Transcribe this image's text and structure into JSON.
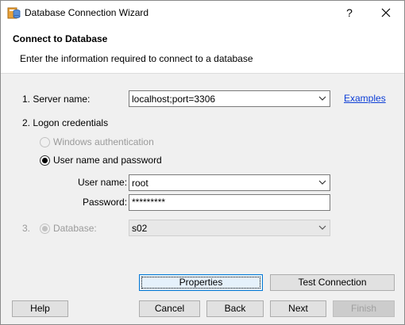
{
  "window": {
    "title": "Database Connection Wizard",
    "help_glyph": "?",
    "icon": "database-wizard-icon"
  },
  "header": {
    "title": "Connect to Database",
    "subtitle": "Enter the information required to connect to a database"
  },
  "server": {
    "label": "1. Server name:",
    "value": "localhost;port=3306",
    "examples_link": "Examples"
  },
  "logon": {
    "label": "2. Logon credentials",
    "windows_auth_label": "Windows authentication",
    "userpass_label": "User name and password",
    "selected": "userpass",
    "username_label": "User name:",
    "username_value": "root",
    "password_label": "Password:",
    "password_value": "*********"
  },
  "database": {
    "number": "3.",
    "label": "Database:",
    "value": "s02"
  },
  "buttons": {
    "properties": "Properties",
    "test_connection": "Test Connection",
    "help": "Help",
    "cancel": "Cancel",
    "back": "Back",
    "next": "Next",
    "finish": "Finish"
  },
  "colors": {
    "link": "#0b3dd6",
    "default_button_border": "#0078d7",
    "dialog_bg": "#f0f0f0"
  }
}
